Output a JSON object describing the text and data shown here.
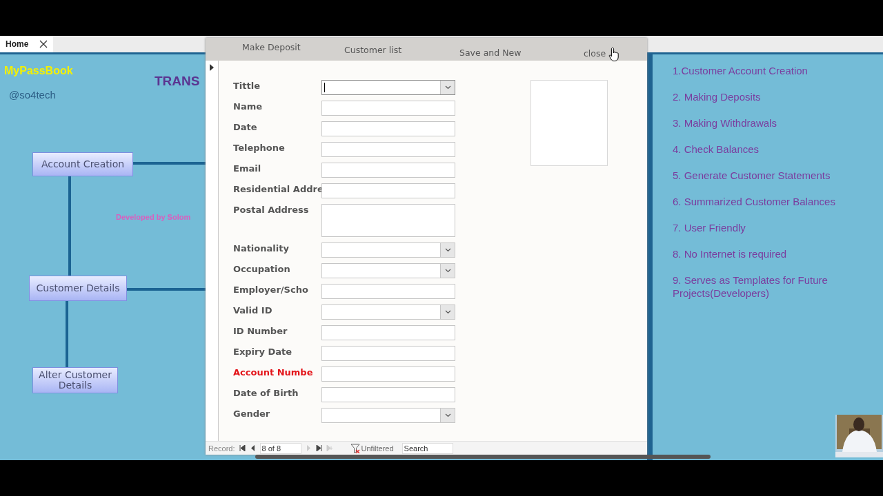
{
  "tabs": [
    {
      "label": "Home",
      "selected": true
    }
  ],
  "home": {
    "app_name": "MyPassBook",
    "handle": "@so4tech",
    "heading": "TRANS",
    "credit": "Developed by Solom",
    "nodes": [
      {
        "label": "Account Creation"
      },
      {
        "label": "Customer Details"
      },
      {
        "label": "Alter Customer Details"
      }
    ]
  },
  "features": [
    "1.Customer Account Creation",
    "2. Making Deposits",
    "3. Making Withdrawals",
    "4. Check Balances",
    "5. Generate Customer Statements",
    "6. Summarized Customer Balances",
    "7. User Friendly",
    "8. No Internet is required",
    "9. Serves as Templates for Future Projects(Developers)"
  ],
  "form": {
    "commands": [
      "Make Deposit",
      "Customer list",
      "Save and New",
      "close"
    ],
    "fields": [
      {
        "label": "Tittle",
        "kind": "combo",
        "emphasized": false,
        "focused": true
      },
      {
        "label": "Name",
        "kind": "text",
        "emphasized": false,
        "focused": false
      },
      {
        "label": "Date",
        "kind": "text",
        "emphasized": false,
        "focused": false
      },
      {
        "label": "Telephone",
        "kind": "text",
        "emphasized": false,
        "focused": false
      },
      {
        "label": "Email",
        "kind": "text",
        "emphasized": false,
        "focused": false
      },
      {
        "label": "Residential Addre",
        "kind": "text",
        "emphasized": false,
        "focused": false
      },
      {
        "label": "Postal Address",
        "kind": "memo",
        "emphasized": false,
        "focused": false
      },
      {
        "label": "Nationality",
        "kind": "combo",
        "emphasized": false,
        "focused": false
      },
      {
        "label": "Occupation",
        "kind": "combo",
        "emphasized": false,
        "focused": false
      },
      {
        "label": "Employer/Scho",
        "kind": "text",
        "emphasized": false,
        "focused": false
      },
      {
        "label": "Valid ID",
        "kind": "combo",
        "emphasized": false,
        "focused": false
      },
      {
        "label": "ID Number",
        "kind": "text",
        "emphasized": false,
        "focused": false
      },
      {
        "label": "Expiry Date",
        "kind": "text",
        "emphasized": false,
        "focused": false
      },
      {
        "label": "Account Numbe",
        "kind": "text",
        "emphasized": true,
        "focused": false
      },
      {
        "label": "Date of Birth",
        "kind": "text",
        "emphasized": false,
        "focused": false
      },
      {
        "label": "Gender",
        "kind": "combo",
        "emphasized": false,
        "focused": false
      }
    ],
    "record_nav": {
      "label": "Record:",
      "position": "8 of 8",
      "filter": "Unfiltered",
      "search": {
        "placeholder": "Search"
      }
    }
  }
}
